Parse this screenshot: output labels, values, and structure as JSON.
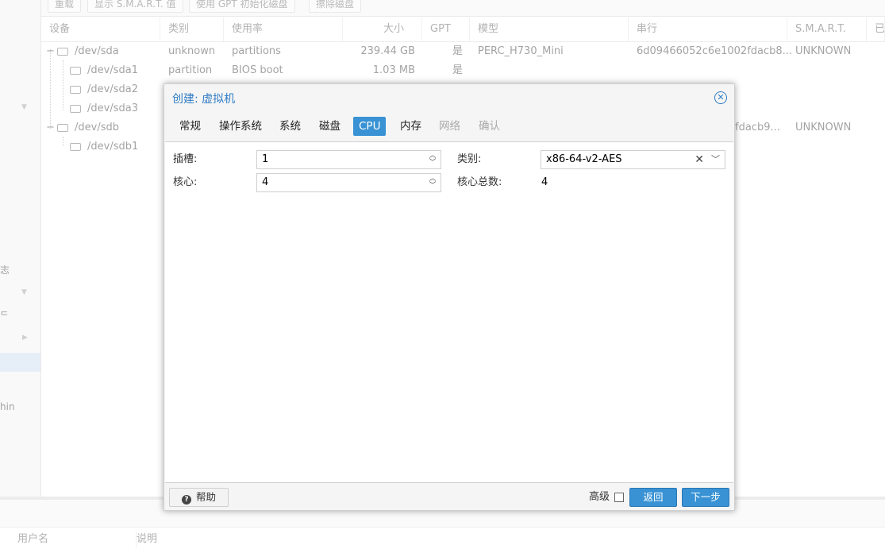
{
  "background": {
    "left_nav_fragments": [
      "志",
      "ᄃ",
      "hin"
    ],
    "toolbar": [
      "重载",
      "显示 S.M.A.R.T. 值",
      "使用 GPT 初始化磁盘",
      "擦除磁盘"
    ],
    "grid": {
      "columns": [
        "设备",
        "类别",
        "使用率",
        "大小",
        "GPT",
        "模型",
        "串行",
        "S.M.A.R.T.",
        "已"
      ],
      "rows": [
        {
          "device": "/dev/sda",
          "type": "unknown",
          "usage": "partitions",
          "size": "239.44 GB",
          "gpt": "是",
          "model": "PERC_H730_Mini",
          "serial": "6d09466052c6e1002fdacb8...",
          "smart": "UNKNOWN"
        },
        {
          "device": "/dev/sda1",
          "type": "partition",
          "usage": "BIOS boot",
          "size": "1.03 MB",
          "gpt": "是",
          "model": "",
          "serial": "",
          "smart": ""
        },
        {
          "device": "/dev/sda2",
          "type": "",
          "usage": "",
          "size": "",
          "gpt": "",
          "model": "",
          "serial": "",
          "smart": ""
        },
        {
          "device": "/dev/sda3",
          "type": "",
          "usage": "",
          "size": "",
          "gpt": "",
          "model": "",
          "serial": "",
          "smart": ""
        },
        {
          "device": "/dev/sdb",
          "type": "",
          "usage": "",
          "size": "",
          "gpt": "",
          "model": "",
          "serial": "fdacb9...",
          "smart": "UNKNOWN"
        },
        {
          "device": "/dev/sdb1",
          "type": "",
          "usage": "",
          "size": "",
          "gpt": "",
          "model": "",
          "serial": "",
          "smart": ""
        }
      ]
    },
    "bottom_columns": [
      "用户名",
      "说明"
    ]
  },
  "dialog": {
    "title": "创建: 虚拟机",
    "tabs": [
      {
        "label": "常规",
        "state": "normal"
      },
      {
        "label": "操作系统",
        "state": "normal"
      },
      {
        "label": "系统",
        "state": "normal"
      },
      {
        "label": "磁盘",
        "state": "normal"
      },
      {
        "label": "CPU",
        "state": "active"
      },
      {
        "label": "内存",
        "state": "normal"
      },
      {
        "label": "网络",
        "state": "disabled"
      },
      {
        "label": "确认",
        "state": "disabled"
      }
    ],
    "fields": {
      "sockets_label": "插槽:",
      "sockets_value": "1",
      "cores_label": "核心:",
      "cores_value": "4",
      "type_label": "类别:",
      "type_value": "x86-64-v2-AES",
      "total_cores_label": "核心总数:",
      "total_cores_value": "4"
    },
    "footer": {
      "help_label": "帮助",
      "advanced_label": "高级",
      "back_label": "返回",
      "next_label": "下一步"
    },
    "accent_color": "#3892d4"
  }
}
